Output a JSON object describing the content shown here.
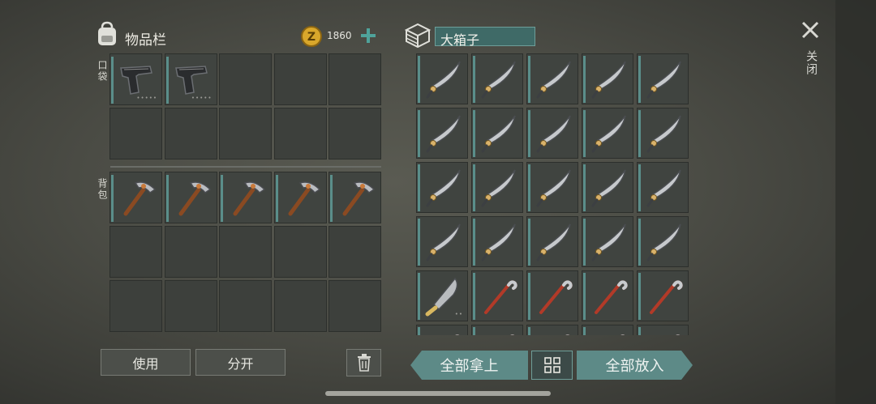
{
  "inventory": {
    "title": "物品栏",
    "coins": "1860",
    "pocket_label": "口袋",
    "backpack_label": "背包",
    "pocket_items": [
      "pistol",
      "pistol",
      "",
      "",
      "",
      "",
      "",
      "",
      "",
      ""
    ],
    "backpack_items": [
      "pickaxe",
      "pickaxe",
      "pickaxe",
      "pickaxe",
      "pickaxe",
      "",
      "",
      "",
      "",
      "",
      "",
      "",
      "",
      "",
      ""
    ]
  },
  "chest": {
    "title": "大箱子",
    "items": [
      "sword",
      "sword",
      "sword",
      "sword",
      "sword",
      "sword",
      "sword",
      "sword",
      "sword",
      "sword",
      "sword",
      "sword",
      "sword",
      "sword",
      "sword",
      "sword",
      "sword",
      "sword",
      "sword",
      "sword",
      "machete",
      "crowbar",
      "crowbar",
      "crowbar",
      "crowbar",
      "crowbar",
      "crowbar",
      "crowbar",
      "crowbar",
      "crowbar"
    ]
  },
  "buttons": {
    "use": "使用",
    "split": "分开",
    "take_all": "全部拿上",
    "put_all": "全部放入"
  },
  "close_label": "关闭",
  "colors": {
    "accent": "#5d8a87",
    "coin": "#d9a72b"
  }
}
